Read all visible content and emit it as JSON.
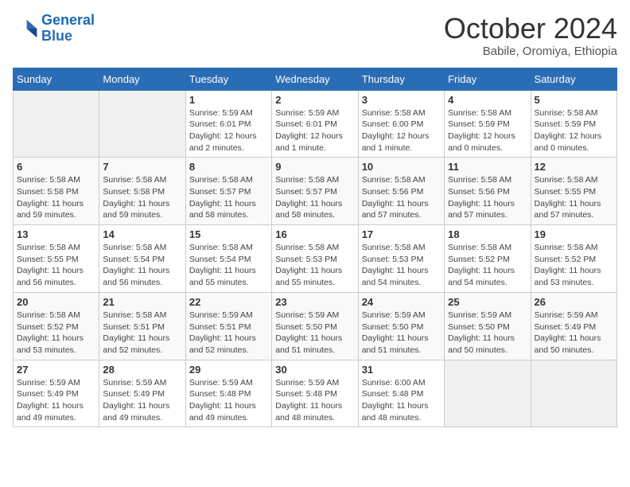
{
  "header": {
    "logo_line1": "General",
    "logo_line2": "Blue",
    "month": "October 2024",
    "location": "Babile, Oromiya, Ethiopia"
  },
  "weekdays": [
    "Sunday",
    "Monday",
    "Tuesday",
    "Wednesday",
    "Thursday",
    "Friday",
    "Saturday"
  ],
  "weeks": [
    [
      {
        "day": null
      },
      {
        "day": null
      },
      {
        "day": "1",
        "sunrise": "5:59 AM",
        "sunset": "6:01 PM",
        "daylight": "12 hours and 2 minutes."
      },
      {
        "day": "2",
        "sunrise": "5:59 AM",
        "sunset": "6:01 PM",
        "daylight": "12 hours and 1 minute."
      },
      {
        "day": "3",
        "sunrise": "5:58 AM",
        "sunset": "6:00 PM",
        "daylight": "12 hours and 1 minute."
      },
      {
        "day": "4",
        "sunrise": "5:58 AM",
        "sunset": "5:59 PM",
        "daylight": "12 hours and 0 minutes."
      },
      {
        "day": "5",
        "sunrise": "5:58 AM",
        "sunset": "5:59 PM",
        "daylight": "12 hours and 0 minutes."
      }
    ],
    [
      {
        "day": "6",
        "sunrise": "5:58 AM",
        "sunset": "5:58 PM",
        "daylight": "11 hours and 59 minutes."
      },
      {
        "day": "7",
        "sunrise": "5:58 AM",
        "sunset": "5:58 PM",
        "daylight": "11 hours and 59 minutes."
      },
      {
        "day": "8",
        "sunrise": "5:58 AM",
        "sunset": "5:57 PM",
        "daylight": "11 hours and 58 minutes."
      },
      {
        "day": "9",
        "sunrise": "5:58 AM",
        "sunset": "5:57 PM",
        "daylight": "11 hours and 58 minutes."
      },
      {
        "day": "10",
        "sunrise": "5:58 AM",
        "sunset": "5:56 PM",
        "daylight": "11 hours and 57 minutes."
      },
      {
        "day": "11",
        "sunrise": "5:58 AM",
        "sunset": "5:56 PM",
        "daylight": "11 hours and 57 minutes."
      },
      {
        "day": "12",
        "sunrise": "5:58 AM",
        "sunset": "5:55 PM",
        "daylight": "11 hours and 57 minutes."
      }
    ],
    [
      {
        "day": "13",
        "sunrise": "5:58 AM",
        "sunset": "5:55 PM",
        "daylight": "11 hours and 56 minutes."
      },
      {
        "day": "14",
        "sunrise": "5:58 AM",
        "sunset": "5:54 PM",
        "daylight": "11 hours and 56 minutes."
      },
      {
        "day": "15",
        "sunrise": "5:58 AM",
        "sunset": "5:54 PM",
        "daylight": "11 hours and 55 minutes."
      },
      {
        "day": "16",
        "sunrise": "5:58 AM",
        "sunset": "5:53 PM",
        "daylight": "11 hours and 55 minutes."
      },
      {
        "day": "17",
        "sunrise": "5:58 AM",
        "sunset": "5:53 PM",
        "daylight": "11 hours and 54 minutes."
      },
      {
        "day": "18",
        "sunrise": "5:58 AM",
        "sunset": "5:52 PM",
        "daylight": "11 hours and 54 minutes."
      },
      {
        "day": "19",
        "sunrise": "5:58 AM",
        "sunset": "5:52 PM",
        "daylight": "11 hours and 53 minutes."
      }
    ],
    [
      {
        "day": "20",
        "sunrise": "5:58 AM",
        "sunset": "5:52 PM",
        "daylight": "11 hours and 53 minutes."
      },
      {
        "day": "21",
        "sunrise": "5:58 AM",
        "sunset": "5:51 PM",
        "daylight": "11 hours and 52 minutes."
      },
      {
        "day": "22",
        "sunrise": "5:59 AM",
        "sunset": "5:51 PM",
        "daylight": "11 hours and 52 minutes."
      },
      {
        "day": "23",
        "sunrise": "5:59 AM",
        "sunset": "5:50 PM",
        "daylight": "11 hours and 51 minutes."
      },
      {
        "day": "24",
        "sunrise": "5:59 AM",
        "sunset": "5:50 PM",
        "daylight": "11 hours and 51 minutes."
      },
      {
        "day": "25",
        "sunrise": "5:59 AM",
        "sunset": "5:50 PM",
        "daylight": "11 hours and 50 minutes."
      },
      {
        "day": "26",
        "sunrise": "5:59 AM",
        "sunset": "5:49 PM",
        "daylight": "11 hours and 50 minutes."
      }
    ],
    [
      {
        "day": "27",
        "sunrise": "5:59 AM",
        "sunset": "5:49 PM",
        "daylight": "11 hours and 49 minutes."
      },
      {
        "day": "28",
        "sunrise": "5:59 AM",
        "sunset": "5:49 PM",
        "daylight": "11 hours and 49 minutes."
      },
      {
        "day": "29",
        "sunrise": "5:59 AM",
        "sunset": "5:48 PM",
        "daylight": "11 hours and 49 minutes."
      },
      {
        "day": "30",
        "sunrise": "5:59 AM",
        "sunset": "5:48 PM",
        "daylight": "11 hours and 48 minutes."
      },
      {
        "day": "31",
        "sunrise": "6:00 AM",
        "sunset": "5:48 PM",
        "daylight": "11 hours and 48 minutes."
      },
      {
        "day": null
      },
      {
        "day": null
      }
    ]
  ]
}
